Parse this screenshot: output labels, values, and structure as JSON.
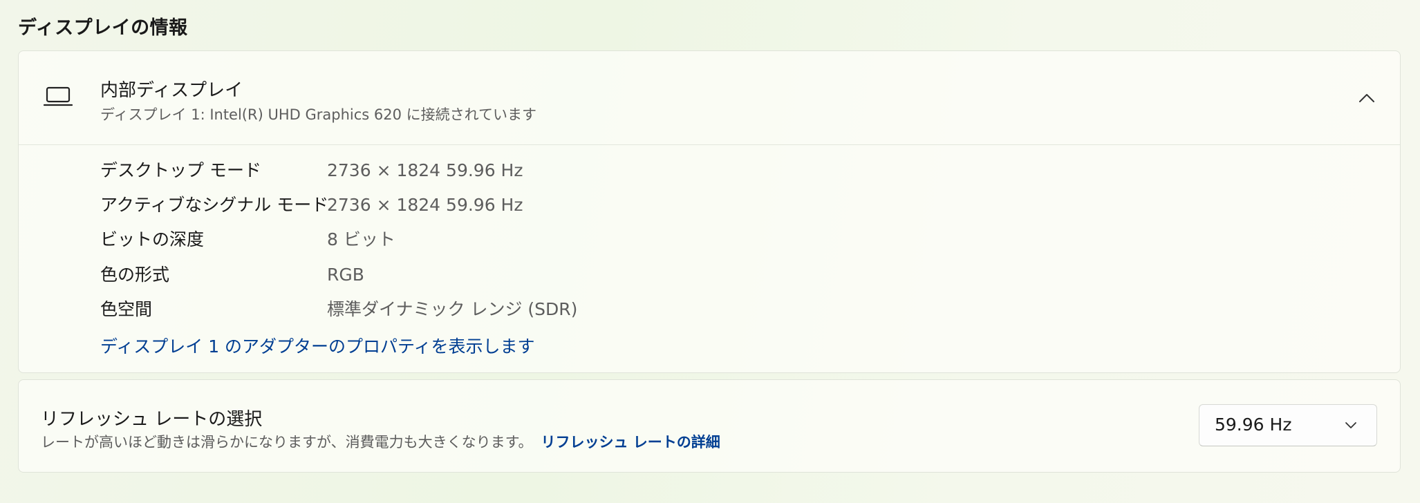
{
  "section_title": "ディスプレイの情報",
  "display": {
    "title": "内部ディスプレイ",
    "subtitle": "ディスプレイ 1: Intel(R) UHD Graphics 620 に接続されています",
    "properties": [
      {
        "label": "デスクトップ モード",
        "value": "2736 × 1824 59.96 Hz"
      },
      {
        "label": "アクティブなシグナル モード",
        "value": "2736 × 1824 59.96 Hz"
      },
      {
        "label": "ビットの深度",
        "value": "8 ビット"
      },
      {
        "label": "色の形式",
        "value": "RGB"
      },
      {
        "label": "色空間",
        "value": "標準ダイナミック レンジ (SDR)"
      }
    ],
    "adapter_link": "ディスプレイ 1 のアダプターのプロパティを表示します"
  },
  "refresh": {
    "title": "リフレッシュ レートの選択",
    "description": "レートが高いほど動きは滑らかになりますが、消費電力も大きくなります。",
    "link": "リフレッシュ レートの詳細",
    "selected": "59.96 Hz"
  },
  "icons": {
    "display_icon": "laptop-icon",
    "collapse_icon": "chevron-up-icon",
    "dropdown_icon": "chevron-down-icon"
  },
  "colors": {
    "link": "#003e92",
    "secondary_text": "#5d5d5d"
  }
}
